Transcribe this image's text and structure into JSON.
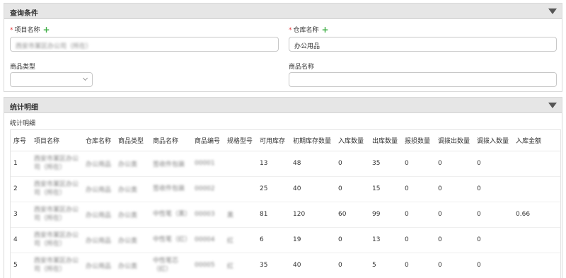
{
  "query_panel": {
    "title": "查询条件",
    "project_name": {
      "label": "项目名称",
      "value": "西安市某区办公司（所在）"
    },
    "warehouse_name": {
      "label": "仓库名称",
      "value": "办公用品"
    },
    "product_type": {
      "label": "商品类型",
      "value": ""
    },
    "product_name": {
      "label": "商品名称",
      "value": ""
    }
  },
  "detail_panel": {
    "title": "统计明细",
    "subtitle": "统计明细",
    "columns": [
      "序号",
      "项目名称",
      "仓库名称",
      "商品类型",
      "商品名称",
      "商品编号",
      "规格型号",
      "可用库存",
      "初期库存数量",
      "入库数量",
      "出库数量",
      "报损数量",
      "调拨出数量",
      "调拨入数量",
      "入库金额"
    ],
    "rows": [
      {
        "seq": "1",
        "project": "西安市某区办公司（所在）",
        "warehouse": "办公用品",
        "type": "办公类",
        "name": "签收件包装",
        "code": "00001",
        "spec": "",
        "available": "13",
        "initial": "48",
        "in": "0",
        "out": "35",
        "loss": "0",
        "transfer_out": "0",
        "transfer_in": "0",
        "amount": ""
      },
      {
        "seq": "2",
        "project": "西安市某区办公司（所在）",
        "warehouse": "办公用品",
        "type": "办公类",
        "name": "签收件包装",
        "code": "00002",
        "spec": "",
        "available": "25",
        "initial": "40",
        "in": "0",
        "out": "15",
        "loss": "0",
        "transfer_out": "0",
        "transfer_in": "0",
        "amount": ""
      },
      {
        "seq": "3",
        "project": "西安市某区办公司（所在）",
        "warehouse": "办公用品",
        "type": "办公类",
        "name": "中性笔（黑）",
        "code": "00003",
        "spec": "黑",
        "available": "81",
        "initial": "120",
        "in": "60",
        "out": "99",
        "loss": "0",
        "transfer_out": "0",
        "transfer_in": "0",
        "amount": "0.66"
      },
      {
        "seq": "4",
        "project": "西安市某区办公司（所在）",
        "warehouse": "办公用品",
        "type": "办公类",
        "name": "中性笔（红）",
        "code": "00004",
        "spec": "红",
        "available": "6",
        "initial": "19",
        "in": "0",
        "out": "13",
        "loss": "0",
        "transfer_out": "0",
        "transfer_in": "0",
        "amount": ""
      },
      {
        "seq": "5",
        "project": "西安市某区办公司（所在）",
        "warehouse": "办公用品",
        "type": "办公类",
        "name": "中性笔芯（红）",
        "code": "00005",
        "spec": "红",
        "available": "35",
        "initial": "40",
        "in": "0",
        "out": "5",
        "loss": "0",
        "transfer_out": "0",
        "transfer_in": "0",
        "amount": ""
      }
    ]
  }
}
